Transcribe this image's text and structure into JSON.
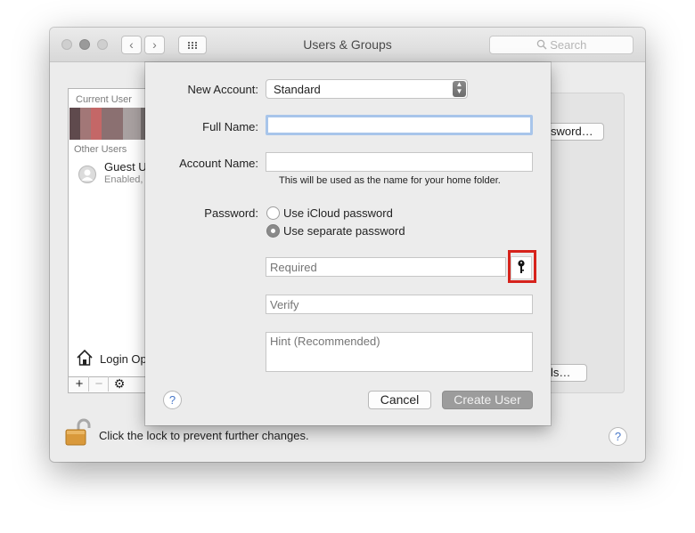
{
  "window": {
    "title": "Users & Groups",
    "search_placeholder": "Search"
  },
  "toolbar": {
    "back_glyph": "‹",
    "forward_glyph": "›"
  },
  "sidebar": {
    "current_user_header": "Current User",
    "other_users_header": "Other Users",
    "guest_name": "Guest U",
    "guest_status": "Enabled,",
    "login_options": "Login Op",
    "add_glyph": "+",
    "remove_glyph": "−",
    "gear_glyph": "⚙"
  },
  "panel": {
    "password_button_partial": "sword…",
    "options_button_partial": "ls…"
  },
  "footer": {
    "lock_text": "Click the lock to prevent further changes.",
    "help_glyph": "?"
  },
  "sheet": {
    "new_account_label": "New Account:",
    "account_type": "Standard",
    "full_name_label": "Full Name:",
    "full_name_value": "",
    "account_name_label": "Account Name:",
    "account_name_value": "",
    "account_name_hint": "This will be used as the name for your home folder.",
    "password_label": "Password:",
    "radio_icloud": "Use iCloud password",
    "radio_separate": "Use separate password",
    "password_placeholder": "Required",
    "verify_placeholder": "Verify",
    "hint_placeholder": "Hint (Recommended)",
    "help_glyph": "?",
    "cancel_label": "Cancel",
    "create_user_label": "Create User"
  },
  "colors": {
    "highlight_box": "#d6231c",
    "help_blue": "#4a79c9",
    "create_button_bg": "#9c9c9c"
  }
}
